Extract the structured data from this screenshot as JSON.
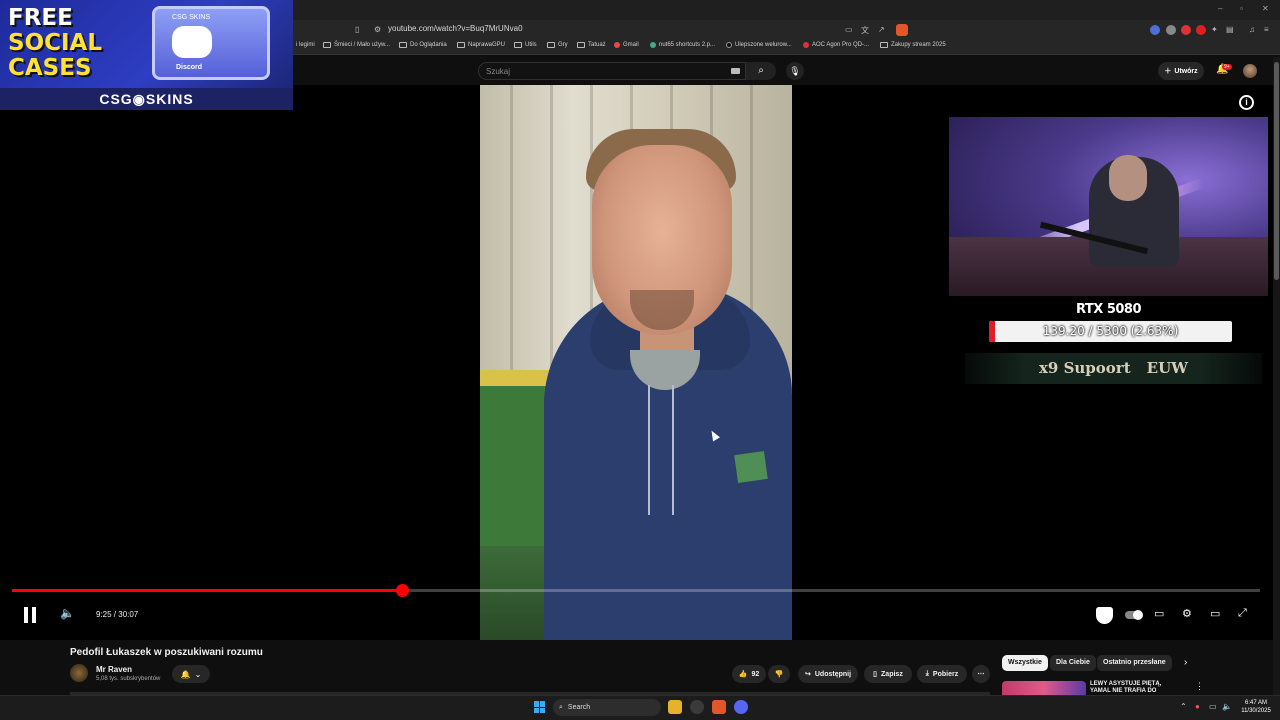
{
  "browser": {
    "url": "youtube.com/watch?v=Buq7MrUNva0",
    "bookmarks": [
      {
        "label": "i legimi",
        "kind": "text"
      },
      {
        "label": "Śmieci / Mało używ...",
        "kind": "folder"
      },
      {
        "label": "Do Oglądania",
        "kind": "folder"
      },
      {
        "label": "NaprawaGPU",
        "kind": "folder"
      },
      {
        "label": "Utils",
        "kind": "folder"
      },
      {
        "label": "Gry",
        "kind": "folder"
      },
      {
        "label": "Tatuaż",
        "kind": "folder"
      },
      {
        "label": "Gmail",
        "kind": "site"
      },
      {
        "label": "nut65 shortcuts 2.p...",
        "kind": "site"
      },
      {
        "label": "Ulepszone welurow...",
        "kind": "site"
      },
      {
        "label": "AOC Agon Pro QD-...",
        "kind": "site"
      },
      {
        "label": "Zakupy stream 2025",
        "kind": "folder"
      }
    ]
  },
  "youtube": {
    "search_placeholder": "Szukaj",
    "create_label": "Utwórz",
    "notif_badge": "9+"
  },
  "ad": {
    "line1": "FREE",
    "line2": "SOCIAL",
    "line3": "CASES",
    "case_brand": "CSG SKINS",
    "case_label": "Discord",
    "brand": "CSG◉SKINS"
  },
  "overlay": {
    "gpu_label": "RTX 5080",
    "progress_text": "139.20 / 5300 (2.63%)",
    "progress_fraction": 0.0263,
    "support_text": "x9 Supoort",
    "region": "EUW"
  },
  "player": {
    "time": "9:25 / 30:07",
    "seek_fraction": 0.3128
  },
  "video": {
    "title": "Pedofil Łukaszek w poszukiwani rozumu",
    "channel": "Mr Raven",
    "subs": "5,08 tys. subskrybentów",
    "likes": "92",
    "share": "Udostępnij",
    "save": "Zapisz",
    "download": "Pobierz"
  },
  "chips": [
    "Wszystkie",
    "Dla Ciebie",
    "Ostatnio przesłane"
  ],
  "recommendation": {
    "title": "LEWY ASYSTUJE PIĘTĄ, YAMAL NIE TRAFIA DO"
  },
  "taskbar": {
    "search": "Search",
    "time": "6:47 AM",
    "date": "11/30/2025"
  }
}
